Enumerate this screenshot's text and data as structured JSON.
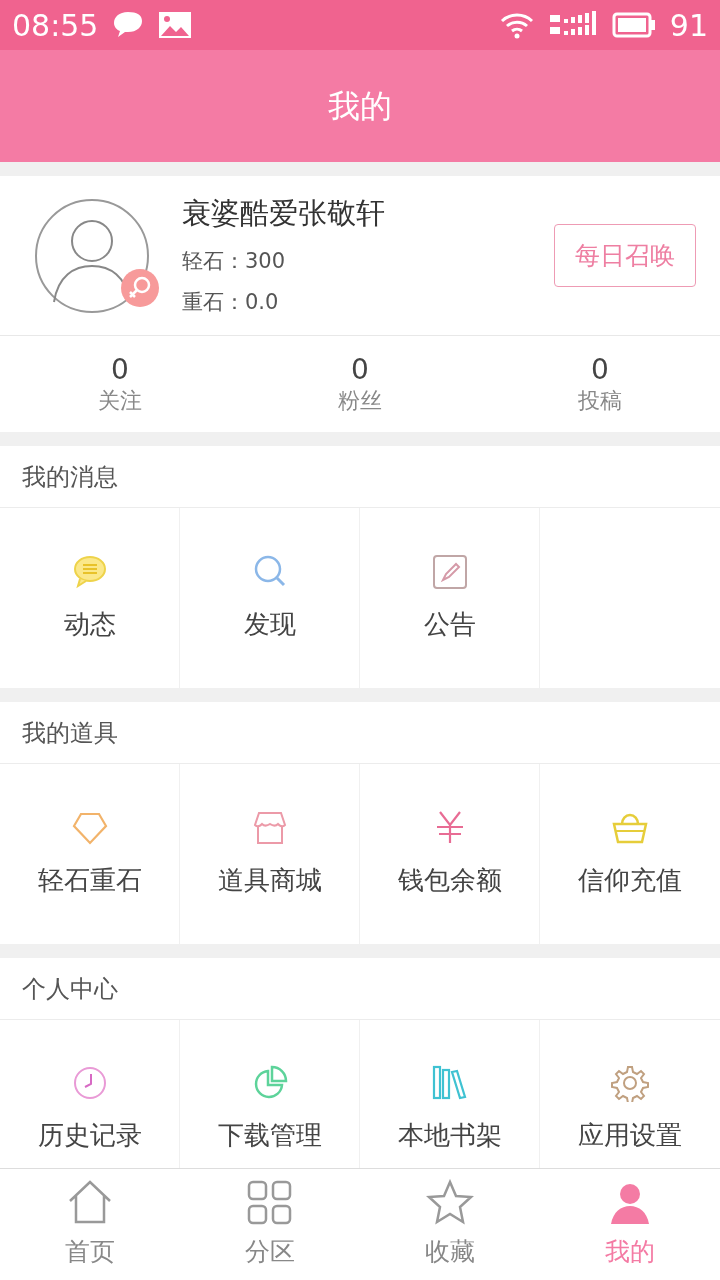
{
  "status_bar": {
    "time": "08:55",
    "battery": "91"
  },
  "header": {
    "title": "我的"
  },
  "profile": {
    "name": "衰婆酷爱张敬轩",
    "light_stone": "轻石：300",
    "heavy_stone": "重石：0.0",
    "button": "每日召唤"
  },
  "stats": [
    {
      "count": "0",
      "label": "关注"
    },
    {
      "count": "0",
      "label": "粉丝"
    },
    {
      "count": "0",
      "label": "投稿"
    }
  ],
  "sections": [
    {
      "title": "我的消息",
      "items": [
        {
          "label": "动态"
        },
        {
          "label": "发现"
        },
        {
          "label": "公告"
        }
      ]
    },
    {
      "title": "我的道具",
      "items": [
        {
          "label": "轻石重石"
        },
        {
          "label": "道具商城"
        },
        {
          "label": "钱包余额"
        },
        {
          "label": "信仰充值"
        }
      ]
    },
    {
      "title": "个人中心",
      "items": [
        {
          "label": "历史记录"
        },
        {
          "label": "下载管理"
        },
        {
          "label": "本地书架"
        },
        {
          "label": "应用设置"
        }
      ]
    }
  ],
  "tab_bar": [
    {
      "label": "首页",
      "selected": false
    },
    {
      "label": "分区",
      "selected": false
    },
    {
      "label": "收藏",
      "selected": false
    },
    {
      "label": "我的",
      "selected": true
    }
  ]
}
